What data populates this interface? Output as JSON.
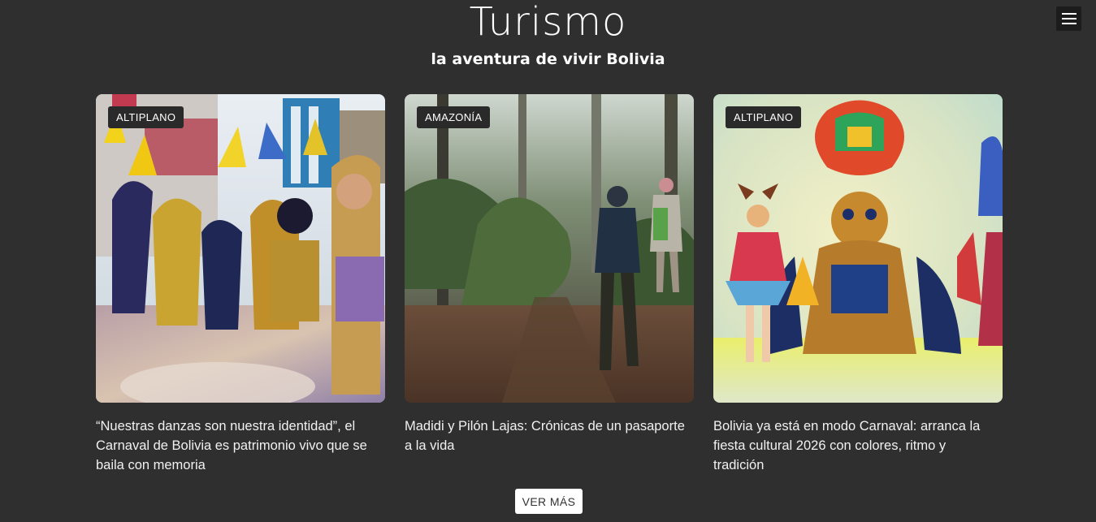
{
  "header": {
    "title": "Turismo",
    "subtitle": "la aventura de vivir Bolivia",
    "menu_icon": "hamburger-menu-icon"
  },
  "cards": [
    {
      "category": "ALTIPLANO",
      "headline": "“Nuestras danzas son nuestra identidad”, el Carnaval de Bolivia es patrimonio vivo que se baila con memoria",
      "image": "carnival-dancers-street-photo"
    },
    {
      "category": "AMAZONÍA",
      "headline": "Madidi y Pilón Lajas: Crónicas de un pasaporte a la vida",
      "image": "hikers-rainforest-trail-photo"
    },
    {
      "category": "ALTIPLANO",
      "headline": "Bolivia ya está en modo Carnaval: arranca la fiesta cultural 2026 con colores, ritmo y tradición",
      "image": "diablada-dancers-painting"
    }
  ],
  "footer": {
    "more_label": "VER MÁS"
  },
  "colors": {
    "background": "#2f2f2f",
    "badge": "#2a2a2a",
    "button": "#ffffff"
  }
}
